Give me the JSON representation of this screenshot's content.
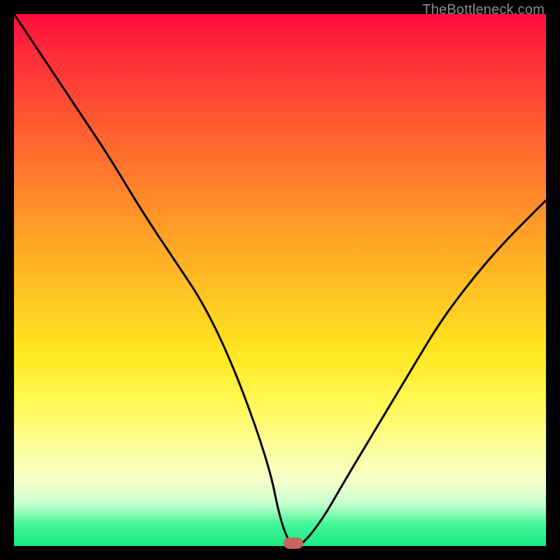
{
  "watermark": "TheBottleneck.com",
  "chart_data": {
    "type": "line",
    "title": "",
    "xlabel": "",
    "ylabel": "",
    "xlim": [
      0,
      100
    ],
    "ylim": [
      0,
      100
    ],
    "series": [
      {
        "name": "bottleneck-curve",
        "x": [
          0,
          6,
          12,
          18,
          24,
          30,
          36,
          42,
          48,
          50,
          52,
          54,
          58,
          62,
          68,
          74,
          80,
          86,
          92,
          100
        ],
        "values": [
          100,
          91,
          82,
          73,
          63,
          54,
          45,
          32,
          15,
          5,
          0,
          0,
          5,
          12,
          22,
          32,
          42,
          50,
          57,
          65
        ]
      }
    ],
    "marker": {
      "x": 52.5,
      "y": 0,
      "label": "optimal-point"
    },
    "background": "heatmap-gradient-red-to-green"
  },
  "colors": {
    "curve": "#000000",
    "marker": "#c9635d"
  }
}
